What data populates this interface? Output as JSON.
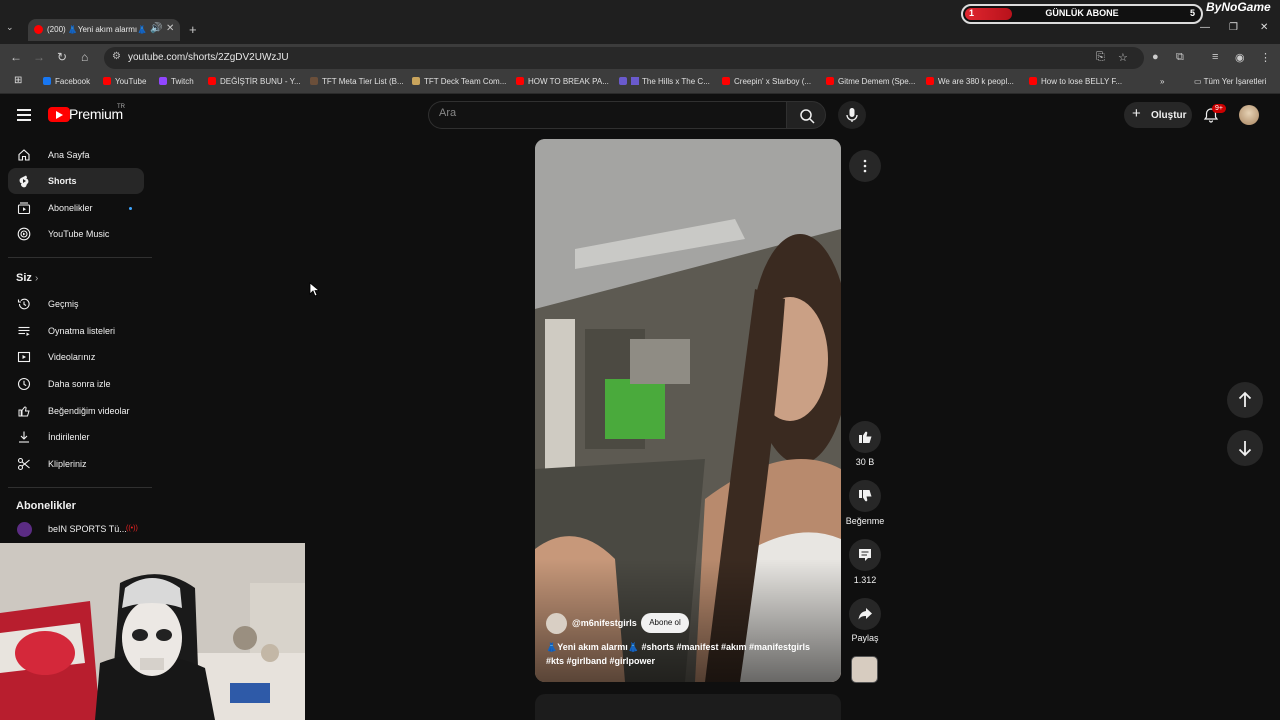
{
  "browser": {
    "tab": {
      "title": "(200) 👗Yeni akım alarmı👗"
    },
    "new_tab": "+",
    "url": "youtube.com/shorts/2ZgDV2UWzJU",
    "bookmarks": [
      {
        "label": "Facebook",
        "color": "#1877f2"
      },
      {
        "label": "YouTube",
        "color": "#ff0000"
      },
      {
        "label": "Twitch",
        "color": "#9146ff"
      },
      {
        "label": "DEĞİŞTİR BUNU - Y...",
        "color": "#ff0000"
      },
      {
        "label": "TFT Meta Tier List (B...",
        "color": "#6b4f3a"
      },
      {
        "label": "TFT Deck Team Com...",
        "color": "#c9a45c"
      },
      {
        "label": "HOW TO BREAK PA...",
        "color": "#ff0000"
      },
      {
        "label": "The Hills x The C...",
        "color": "#6a5acd"
      },
      {
        "label": "Creepin' x Starboy (...",
        "color": "#ff0000"
      },
      {
        "label": "Gitme Demem (Spe...",
        "color": "#ff0000"
      },
      {
        "label": "We are 380 k peopl...",
        "color": "#ff0000"
      },
      {
        "label": "How to lose BELLY F...",
        "color": "#ff0000"
      }
    ],
    "all_bookmarks": "Tüm Yer İşaretleri"
  },
  "overlay": {
    "left_count": "1",
    "title": "GÜNLÜK ABONE",
    "right_count": "5",
    "progress": 0.2,
    "brand": "ByNoGame"
  },
  "header": {
    "logo_text": "Premium",
    "logo_region": "TR",
    "search_placeholder": "Ara",
    "create_label": "Oluştur",
    "notification_badge": "9+"
  },
  "sidebar": {
    "main": [
      {
        "label": "Ana Sayfa",
        "icon": "home-icon"
      },
      {
        "label": "Shorts",
        "icon": "shorts-icon",
        "active": true
      },
      {
        "label": "Abonelikler",
        "icon": "subscriptions-icon"
      },
      {
        "label": "YouTube Music",
        "icon": "music-icon"
      }
    ],
    "you_heading": "Siz",
    "you": [
      {
        "label": "Geçmiş",
        "icon": "history-icon"
      },
      {
        "label": "Oynatma listeleri",
        "icon": "playlist-icon"
      },
      {
        "label": "Videolarınız",
        "icon": "your-videos-icon"
      },
      {
        "label": "Daha sonra izle",
        "icon": "watch-later-icon"
      },
      {
        "label": "Beğendiğim videolar",
        "icon": "liked-icon"
      },
      {
        "label": "İndirilenler",
        "icon": "download-icon"
      },
      {
        "label": "Klipleriniz",
        "icon": "clips-icon"
      }
    ],
    "subs_heading": "Abonelikler",
    "subs": [
      {
        "label": "beIN SPORTS Tü..."
      }
    ]
  },
  "short": {
    "channel": "@m6nifestgirls",
    "subscribe_label": "Abone ol",
    "caption_line1": "👗Yeni akım alarmı👗 #shorts #manifest #akım #manifestgirls",
    "caption_line2": "#kts #girlband #girlpower",
    "likes": "30 B",
    "dislike_label": "Beğenme",
    "comments": "1.312",
    "share_label": "Paylaş"
  }
}
